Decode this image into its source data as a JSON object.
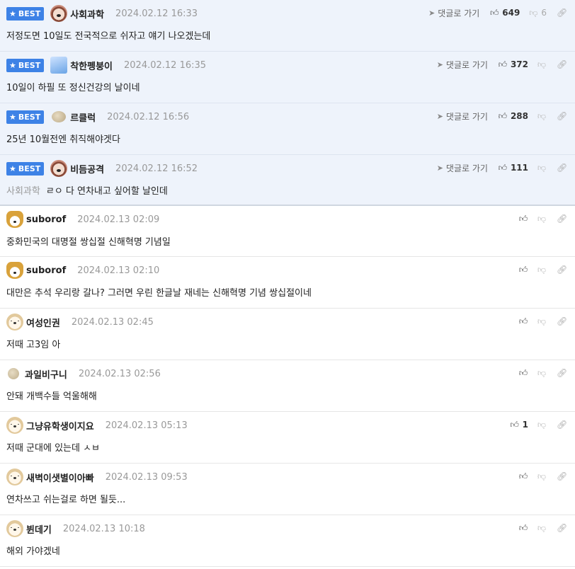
{
  "labels": {
    "best": "BEST",
    "goto": "댓글로 가기"
  },
  "best_comments": [
    {
      "nick": "사회과학",
      "date": "2024.02.12 16:33",
      "mention": "",
      "text": "저정도면 10일도 전국적으로 쉬자고 얘기 나오겠는데",
      "likes": "649",
      "dislikes": "6",
      "avatar": "dog-avatar"
    },
    {
      "nick": "착한펭붕이",
      "date": "2024.02.12 16:35",
      "mention": "",
      "text": "10일이 하필 또 정신건강의 날이네",
      "likes": "372",
      "dislikes": "",
      "avatar": "blue-avatar"
    },
    {
      "nick": "르클럭",
      "date": "2024.02.12 16:56",
      "mention": "",
      "text": "25년 10월전엔 취직해야겟다",
      "likes": "288",
      "dislikes": "",
      "avatar": "stone-avatar"
    },
    {
      "nick": "비듬공격",
      "date": "2024.02.12 16:52",
      "mention": "사회과학",
      "text": "ㄹㅇ 다 연차내고 싶어할 날인데",
      "likes": "111",
      "dislikes": "",
      "avatar": "dog-avatar"
    }
  ],
  "comments": [
    {
      "nick": "suborof",
      "date": "2024.02.13 02:09",
      "text": "중화민국의 대명절 쌍십절 신해혁명 기념일",
      "likes": "",
      "avatar": "fox-avatar"
    },
    {
      "nick": "suborof",
      "date": "2024.02.13 02:10",
      "text": "대만은 추석 우리랑 갈나? 그러면 우린 한글날 재네는 신해혁명 기념 쌍십절이네",
      "likes": "",
      "avatar": "fox-avatar"
    },
    {
      "nick": "여성인권",
      "date": "2024.02.13 02:45",
      "text": "저때 고3임 아",
      "likes": "",
      "avatar": "puppy-avatar"
    },
    {
      "nick": "과일비구니",
      "date": "2024.02.13 02:56",
      "text": "안돼 개백수들 억울해해",
      "likes": "",
      "avatar": "dot-avatar"
    },
    {
      "nick": "그냥유학생이지요",
      "date": "2024.02.13 05:13",
      "text": "저때 군대에 있는데 ㅅㅂ",
      "likes": "1",
      "avatar": "puppy-avatar"
    },
    {
      "nick": "새벽이샛별이아빠",
      "date": "2024.02.13 09:53",
      "text": "연차쓰고 쉬는걸로 하면 될듯...",
      "likes": "",
      "avatar": "puppy-avatar"
    },
    {
      "nick": "뷘데기",
      "date": "2024.02.13 10:18",
      "text": "해외 가야겠네",
      "likes": "",
      "avatar": "puppy-avatar"
    }
  ],
  "colors": {
    "accent": "#3d82e6",
    "best_bg": "#eef3fb"
  },
  "icons": [
    "star-icon",
    "send-arrow-icon",
    "thumbs-up-icon",
    "thumbs-down-icon",
    "link-icon"
  ]
}
